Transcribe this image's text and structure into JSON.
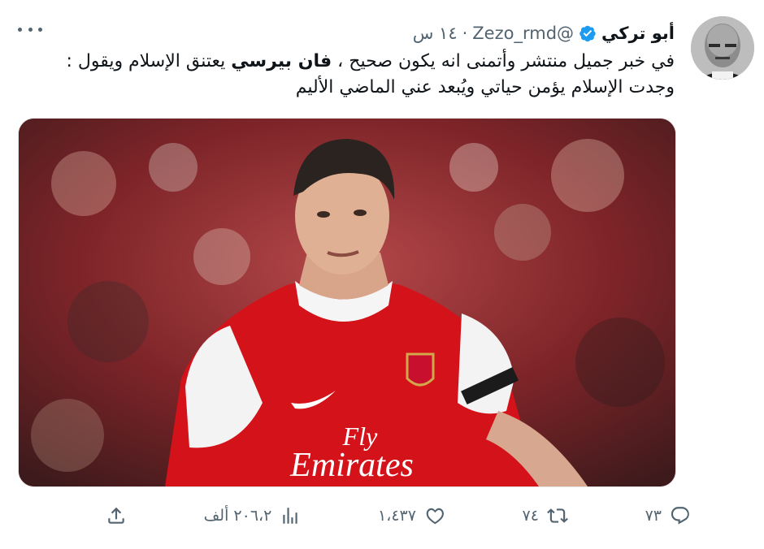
{
  "tweet": {
    "author_name": "أبو تركي",
    "handle": "Zezo_rmd@",
    "separator": "·",
    "time": "١٤ س",
    "text_part1": "في خبر جميل منتشر وأتمنى انه يكون صحيح ، ",
    "text_bold": "فان بيرسي",
    "text_part2": " يعتنق الإسلام ويقول : وجدت الإسلام يؤمن حياتي ويُبعد عني الماضي الأليم",
    "media_shirt_sponsor_line1": "Fly",
    "media_shirt_sponsor_line2": "Emirates",
    "colors": {
      "verified": "#1d9bf0",
      "muted": "#536471",
      "text": "#0f1419",
      "shirt_red": "#d4121a"
    }
  },
  "actions": {
    "reply_count": "٧٣",
    "retweet_count": "٧٤",
    "like_count": "١،٤٣٧",
    "views_count": "٢٠٦،٢ ألف",
    "icons": [
      "reply-icon",
      "retweet-icon",
      "like-icon",
      "views-icon",
      "share-icon"
    ]
  }
}
